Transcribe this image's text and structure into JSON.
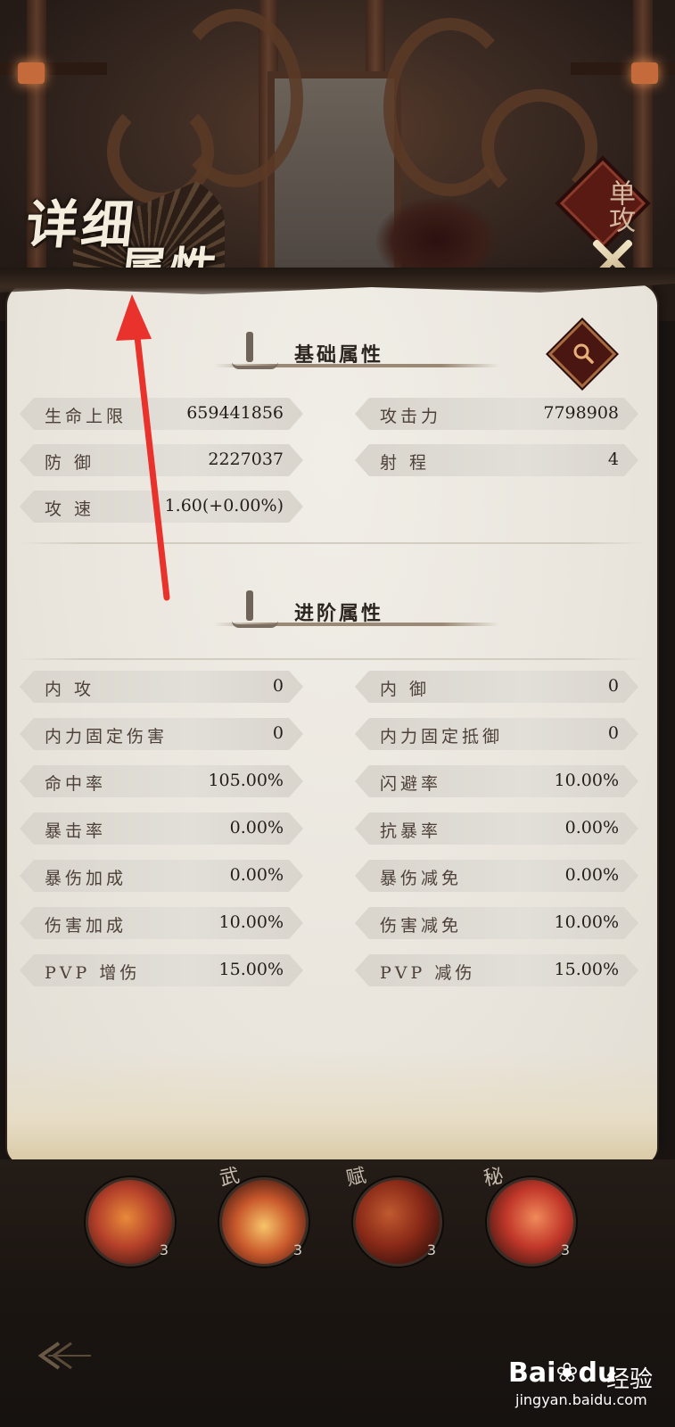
{
  "title": {
    "line1": "详细",
    "line2": "属性"
  },
  "mode_badge": "单攻",
  "sections": {
    "basic": {
      "label": "基础属性"
    },
    "advanced": {
      "label": "进阶属性"
    }
  },
  "basic_stats": [
    {
      "name": "生命上限",
      "value": "659441856"
    },
    {
      "name": "攻击力",
      "value": "7798908"
    },
    {
      "name": "防 御",
      "value": "2227037"
    },
    {
      "name": "射 程",
      "value": "4"
    },
    {
      "name": "攻 速",
      "value": "1.60(+0.00%)"
    }
  ],
  "advanced_stats": [
    {
      "name": "内 攻",
      "value": "0"
    },
    {
      "name": "内 御",
      "value": "0"
    },
    {
      "name": "内力固定伤害",
      "value": "0"
    },
    {
      "name": "内力固定抵御",
      "value": "0"
    },
    {
      "name": "命中率",
      "value": "105.00%"
    },
    {
      "name": "闪避率",
      "value": "10.00%"
    },
    {
      "name": "暴击率",
      "value": "0.00%"
    },
    {
      "name": "抗暴率",
      "value": "0.00%"
    },
    {
      "name": "暴伤加成",
      "value": "0.00%"
    },
    {
      "name": "暴伤减免",
      "value": "0.00%"
    },
    {
      "name": "伤害加成",
      "value": "10.00%"
    },
    {
      "name": "伤害减免",
      "value": "10.00%"
    },
    {
      "name": "PVP 增伤",
      "value": "15.00%"
    },
    {
      "name": "PVP 减伤",
      "value": "15.00%"
    }
  ],
  "skills": [
    {
      "tag": "",
      "level": "3",
      "icon": "flame-figure-icon",
      "color": "#b5412a"
    },
    {
      "tag": "武",
      "level": "3",
      "icon": "lotus-fire-icon",
      "color": "#c9592c"
    },
    {
      "tag": "赋",
      "level": "3",
      "icon": "phoenix-feather-icon",
      "color": "#8a2a18"
    },
    {
      "tag": "秘",
      "level": "3",
      "icon": "red-swirl-icon",
      "color": "#c2382a"
    }
  ],
  "watermark": {
    "brand": "Bai",
    "paw": "du",
    "jingyan": "经验",
    "url": "jingyan.baidu.com"
  },
  "colors": {
    "accent": "#5a1a14",
    "panel": "#ebe7df",
    "stat_bg": "#dcd8d0",
    "arrow": "#e8322b"
  }
}
